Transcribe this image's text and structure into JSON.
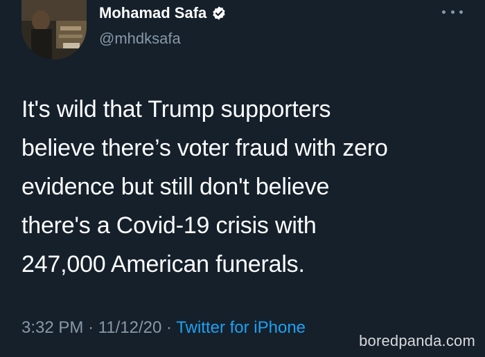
{
  "author": {
    "name": "Mohamad Safa",
    "handle": "@mhdksafa",
    "verified": true
  },
  "tweet": {
    "lines": [
      "It's wild that Trump supporters",
      "believe there’s voter fraud with zero",
      "evidence but still don't believe",
      "there's a Covid-19 crisis with",
      "247,000 American funerals."
    ]
  },
  "meta": {
    "time": "3:32 PM",
    "separator": "·",
    "date": "11/12/20",
    "source": "Twitter for iPhone"
  },
  "watermark": "boredpanda.com",
  "icons": {
    "verified": "verified-badge-icon",
    "more": "more-options-icon"
  },
  "colors": {
    "background": "#15202b",
    "text": "#ffffff",
    "secondary": "#8899a6",
    "accent": "#1da1f2"
  }
}
